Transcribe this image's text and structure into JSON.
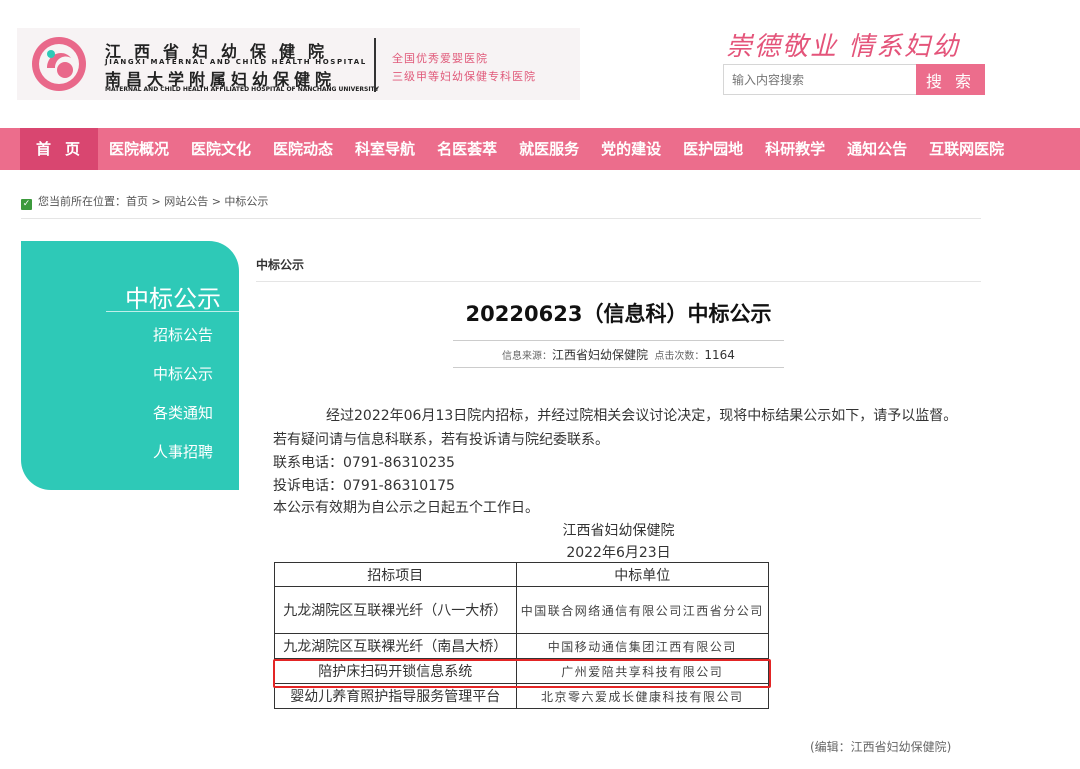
{
  "header": {
    "logo": {
      "cn_line1": "江西省妇幼保健院",
      "en_line1": "JIANGXI MATERNAL AND CHILD HEALTH HOSPITAL",
      "cn_line2": "南昌大学附属妇幼保健院",
      "en_line2": "MATERNAL AND CHILD HEALTH AFFILIATED HOSPITAL OF NANCHANG UNIVERSITY",
      "slogan_line1": "全国优秀爱婴医院",
      "slogan_line2": "三级甲等妇幼保健专科医院"
    },
    "motto": "崇德敬业 情系妇幼",
    "search": {
      "placeholder": "输入内容搜索",
      "button_label": "搜 索"
    },
    "colors": {
      "brand_pink": "#ec6d8c",
      "teal": "#2ec9b7"
    }
  },
  "nav": {
    "items": [
      "首页",
      "医院概况",
      "医院文化",
      "医院动态",
      "科室导航",
      "名医荟萃",
      "就医服务",
      "党的建设",
      "医护园地",
      "科研教学",
      "通知公告",
      "互联网医院"
    ]
  },
  "breadcrumb": {
    "text": "您当前所在位置：首页 > 网站公告 > 中标公示"
  },
  "sidebar": {
    "title": "中标公示",
    "items": [
      "招标公告",
      "中标公示",
      "各类通知",
      "人事招聘"
    ]
  },
  "article": {
    "section_title": "中标公示",
    "title": "20220623（信息科）中标公示",
    "meta": {
      "source_label": "信息来源：",
      "source": "江西省妇幼保健院",
      "views_label": "点击次数：",
      "views": "1164"
    },
    "para1": "经过2022年06月13日院内招标，并经过院相关会议讨论决定，现将中标结果公示如下，请予以监督。",
    "para2": "若有疑问请与信息科联系，若有投诉请与院纪委联系。",
    "contact": "联系电话：0791-86310235",
    "complaint": "投诉电话：0791-86310175",
    "validity": "本公示有效期为自公示之日起五个工作日。",
    "signature": "江西省妇幼保健院",
    "date": "2022年6月23日",
    "table": {
      "headers": [
        "招标项目",
        "中标单位"
      ],
      "rows": [
        [
          "九龙湖院区互联裸光纤（八一大桥）",
          "中国联合网络通信有限公司江西省分公司"
        ],
        [
          "九龙湖院区互联裸光纤（南昌大桥）",
          "中国移动通信集团江西有限公司"
        ],
        [
          "陪护床扫码开锁信息系统",
          "广州爱陪共享科技有限公司"
        ],
        [
          "婴幼儿养育照护指导服务管理平台",
          "北京零六爱成长健康科技有限公司"
        ]
      ]
    },
    "editor": "(编辑：江西省妇幼保健院)"
  }
}
